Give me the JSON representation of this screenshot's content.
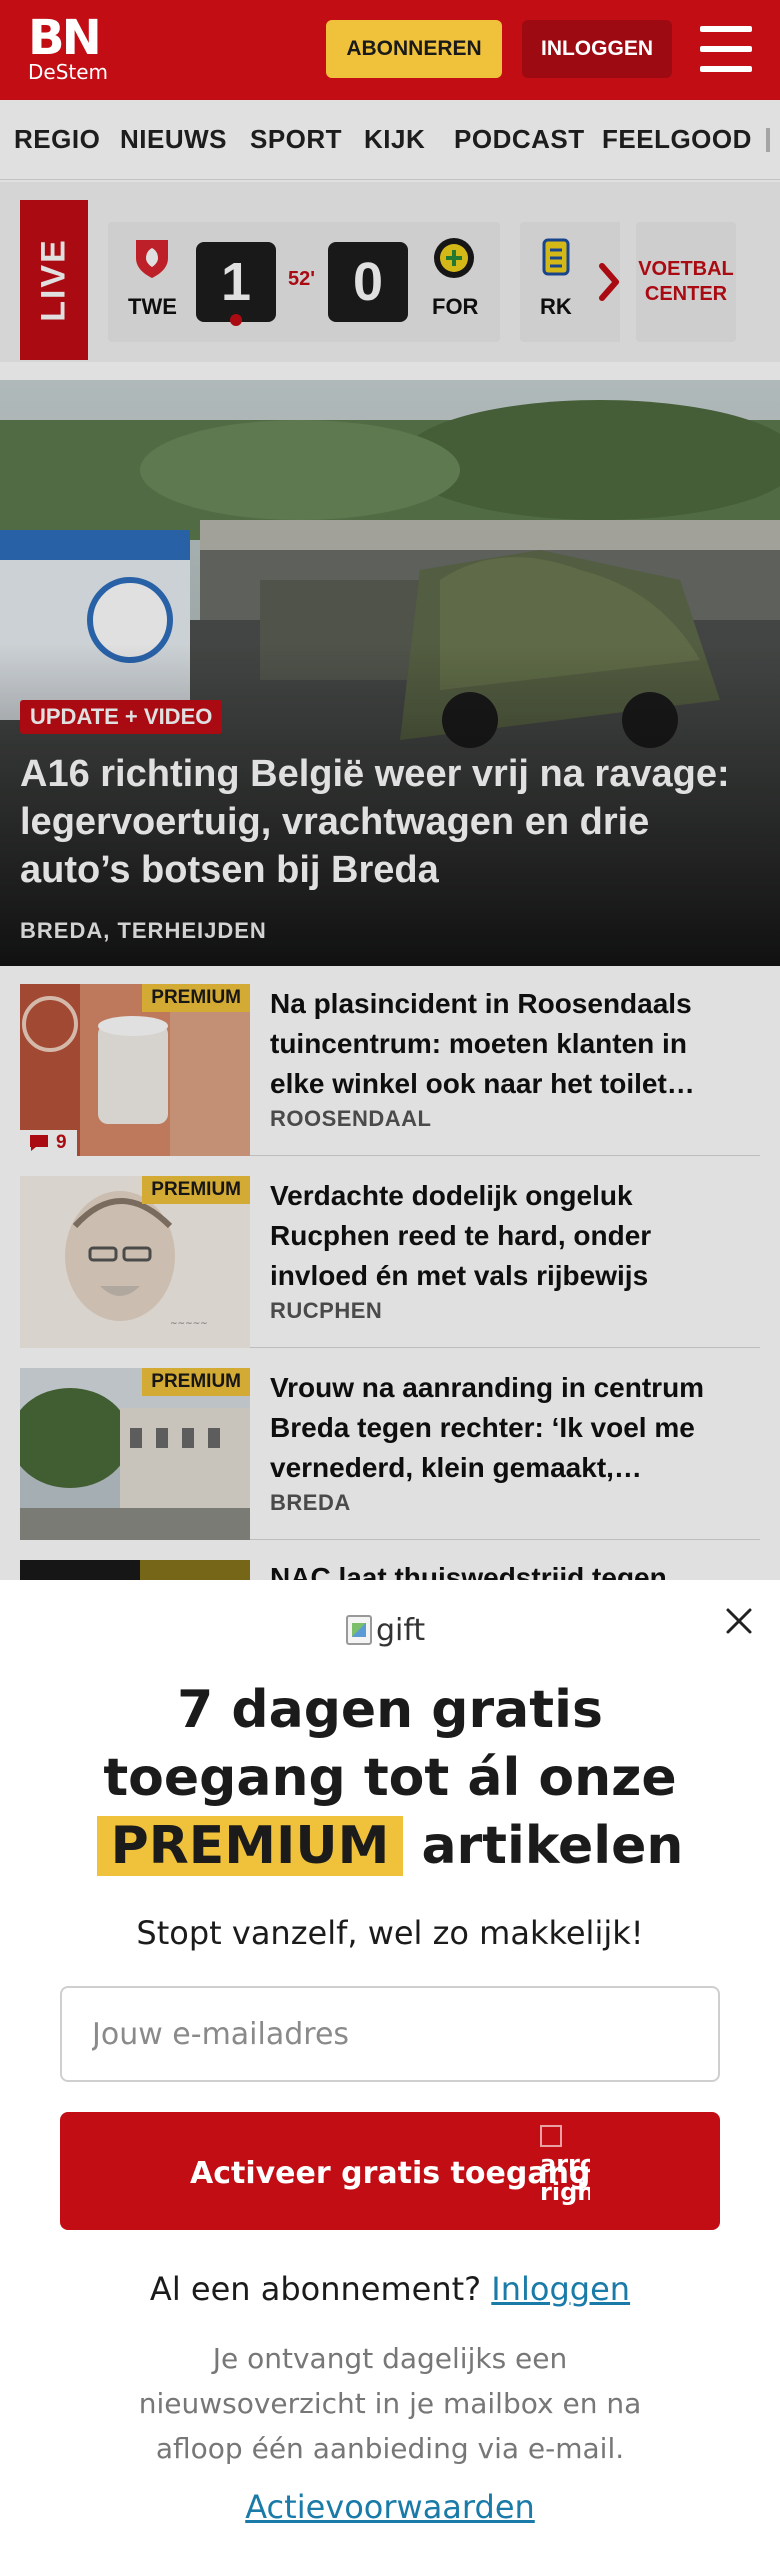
{
  "header": {
    "logo_main": "BN",
    "logo_sub": "DeStem",
    "subscribe_label": "ABONNEREN",
    "login_label": "INLOGGEN"
  },
  "nav": {
    "items": [
      "REGIO",
      "NIEUWS",
      "SPORT",
      "KIJK",
      "PODCAST",
      "FEELGOOD"
    ]
  },
  "scores": {
    "live_label": "LIVE",
    "match": {
      "home_code": "TWE",
      "away_code": "FOR",
      "home_score": "1",
      "away_score": "0",
      "minute": "52'"
    },
    "next_team_code": "RK",
    "voetbal_center_label": "VOETBAL\nCENTER"
  },
  "hero": {
    "badge": "UPDATE + VIDEO",
    "title": "A16 richting België weer vrij na ravage: legervoertuig, vrachtwagen en drie auto’s botsen bij Breda",
    "place": "BREDA, TERHEIJDEN"
  },
  "articles": [
    {
      "premium": "PREMIUM",
      "title": "Na plasincident in Roosendaals tuincentrum: moeten klanten in elke winkel ook naar het toilet…",
      "place": "ROOSENDAAL",
      "comments": "9"
    },
    {
      "premium": "PREMIUM",
      "title": "Verdachte dodelijk ongeluk Rucphen reed te hard, onder invloed én met vals rijbewijs",
      "place": "RUCPHEN"
    },
    {
      "premium": "PREMIUM",
      "title": "Vrouw na aanranding in centrum Breda tegen rechter: ‘Ik voel me vernederd, klein gemaakt,…",
      "place": "BREDA"
    },
    {
      "title": "NAC laat thuiswedstrijd tegen"
    }
  ],
  "promo": {
    "gift_alt": "gift",
    "title_line1": "7 dagen gratis",
    "title_line2": "toegang tot ál onze",
    "title_highlight": "PREMIUM",
    "title_end": "artikelen",
    "subtitle": "Stopt vanzelf, wel zo makkelijk!",
    "email_placeholder": "Jouw e-mailadres",
    "cta_label": "Activeer gratis toegang",
    "cta_img_alt": "arrow right",
    "already_text": "Al een abonnement?",
    "already_link": "Inloggen",
    "disclaimer": "Je ontvangt dagelijks een nieuwsoverzicht in je mailbox en na afloop één aanbieding via e-mail.",
    "terms_link": "Actievoorwaarden"
  },
  "colors": {
    "brand_red": "#c20d15",
    "premium_yellow": "#f0c23c",
    "link_blue": "#1a7aa8"
  }
}
